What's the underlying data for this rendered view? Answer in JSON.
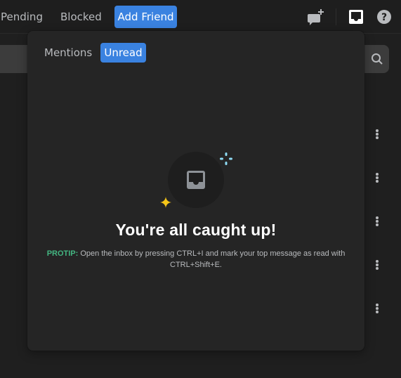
{
  "topbar": {
    "tabs": [
      {
        "label": "Pending",
        "active": false
      },
      {
        "label": "Blocked",
        "active": false
      },
      {
        "label": "Add Friend",
        "active": true
      }
    ],
    "icons": [
      "new-group-dm-icon",
      "inbox-icon",
      "help-icon"
    ]
  },
  "background": {
    "search_icon": "search-icon",
    "row_menus": 5
  },
  "inbox_popover": {
    "tabs": [
      {
        "label": "Mentions",
        "active": false
      },
      {
        "label": "Unread",
        "active": true
      }
    ],
    "empty_state": {
      "title": "You're all caught up!",
      "protip_label": "PROTIP:",
      "protip_text": " Open the inbox by pressing CTRL+I and mark your top message as read with CTRL+Shift+E."
    }
  },
  "colors": {
    "accent": "#3a82e0",
    "protip": "#43b581",
    "sparkle_yellow": "#f5c518",
    "sparkle_blue": "#8fdcf5"
  }
}
